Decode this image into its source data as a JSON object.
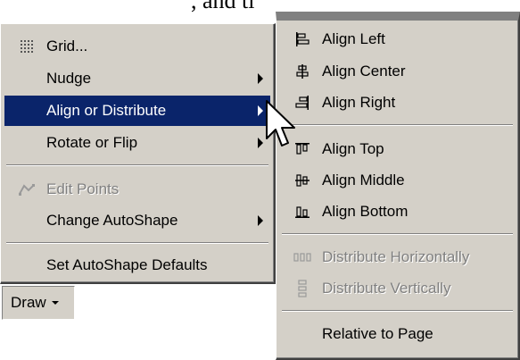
{
  "background_text": ", and tl",
  "main_menu": {
    "items": [
      {
        "label": "Grid...",
        "icon": "grid-icon",
        "submenu": false,
        "disabled": false,
        "selected": false
      },
      {
        "label": "Nudge",
        "icon": "",
        "submenu": true,
        "disabled": false,
        "selected": false
      },
      {
        "label": "Align or Distribute",
        "icon": "",
        "submenu": true,
        "disabled": false,
        "selected": true
      },
      {
        "label": "Rotate or Flip",
        "icon": "",
        "submenu": true,
        "disabled": false,
        "selected": false
      },
      {
        "label": "Edit Points",
        "icon": "edit-points-icon",
        "submenu": false,
        "disabled": true,
        "selected": false
      },
      {
        "label": "Change AutoShape",
        "icon": "",
        "submenu": true,
        "disabled": false,
        "selected": false
      },
      {
        "label": "Set AutoShape Defaults",
        "icon": "",
        "submenu": false,
        "disabled": false,
        "selected": false
      }
    ]
  },
  "sub_menu": {
    "items": [
      {
        "label": "Align Left",
        "icon": "align-left-icon",
        "disabled": false
      },
      {
        "label": "Align Center",
        "icon": "align-center-icon",
        "disabled": false
      },
      {
        "label": "Align Right",
        "icon": "align-right-icon",
        "disabled": false
      },
      {
        "label": "Align Top",
        "icon": "align-top-icon",
        "disabled": false
      },
      {
        "label": "Align Middle",
        "icon": "align-middle-icon",
        "disabled": false
      },
      {
        "label": "Align Bottom",
        "icon": "align-bottom-icon",
        "disabled": false
      },
      {
        "label": "Distribute Horizontally",
        "icon": "distribute-horizontally-icon",
        "disabled": true
      },
      {
        "label": "Distribute Vertically",
        "icon": "distribute-vertically-icon",
        "disabled": true
      },
      {
        "label": "Relative to Page",
        "icon": "",
        "disabled": false
      }
    ]
  },
  "draw_button": {
    "label": "Draw"
  },
  "colors": {
    "menu_face": "#d4d0c8",
    "highlight": "#0a246a",
    "highlight_text": "#ffffff",
    "disabled_text": "#808080"
  }
}
